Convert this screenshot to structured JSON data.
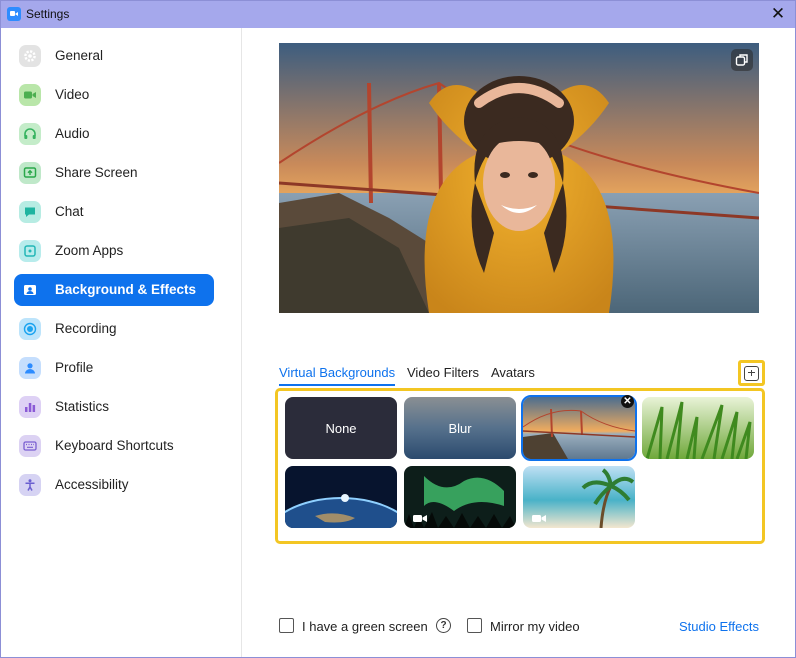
{
  "window": {
    "title": "Settings",
    "close_icon": "close-icon"
  },
  "sidebar": {
    "items": [
      {
        "label": "General",
        "icon": "gear-icon",
        "color": "#8a8a8a",
        "active": false
      },
      {
        "label": "Video",
        "icon": "video-camera-icon",
        "color": "#4caf50",
        "active": false
      },
      {
        "label": "Audio",
        "icon": "headphones-icon",
        "color": "#35b35f",
        "active": false
      },
      {
        "label": "Share Screen",
        "icon": "share-screen-icon",
        "color": "#2aa84a",
        "active": false
      },
      {
        "label": "Chat",
        "icon": "chat-bubble-icon",
        "color": "#1fb4a0",
        "active": false
      },
      {
        "label": "Zoom Apps",
        "icon": "apps-icon",
        "color": "#22b7b7",
        "active": false
      },
      {
        "label": "Background & Effects",
        "icon": "person-card-icon",
        "color": "#0e72ed",
        "active": true
      },
      {
        "label": "Recording",
        "icon": "record-icon",
        "color": "#1aa3f0",
        "active": false
      },
      {
        "label": "Profile",
        "icon": "person-icon",
        "color": "#2d8cff",
        "active": false
      },
      {
        "label": "Statistics",
        "icon": "bar-chart-icon",
        "color": "#8b5ad6",
        "active": false
      },
      {
        "label": "Keyboard Shortcuts",
        "icon": "keyboard-icon",
        "color": "#7a5ed1",
        "active": false
      },
      {
        "label": "Accessibility",
        "icon": "accessibility-icon",
        "color": "#6a5fd0",
        "active": false
      }
    ]
  },
  "preview": {
    "pip_icon": "picture-in-picture-icon"
  },
  "tabs": [
    {
      "label": "Virtual Backgrounds",
      "active": true
    },
    {
      "label": "Video Filters",
      "active": false
    },
    {
      "label": "Avatars",
      "active": false
    }
  ],
  "add_button": {
    "icon": "add-icon"
  },
  "backgrounds": [
    {
      "label": "None",
      "kind": "none",
      "selected": false,
      "video": false
    },
    {
      "label": "Blur",
      "kind": "blur",
      "selected": false,
      "video": false
    },
    {
      "label": "",
      "kind": "golden-gate-bridge",
      "selected": true,
      "video": false
    },
    {
      "label": "",
      "kind": "grass",
      "selected": false,
      "video": false
    },
    {
      "label": "",
      "kind": "earth-from-space",
      "selected": false,
      "video": false
    },
    {
      "label": "",
      "kind": "aurora",
      "selected": false,
      "video": true
    },
    {
      "label": "",
      "kind": "beach-palm",
      "selected": false,
      "video": true
    }
  ],
  "footer": {
    "green_screen_label": "I have a green screen",
    "green_screen_checked": false,
    "help_icon": "help-icon",
    "mirror_label": "Mirror my video",
    "mirror_checked": false,
    "studio_effects_label": "Studio Effects"
  },
  "colors": {
    "accent": "#0e72ed",
    "highlight": "#f3c623",
    "titlebar": "#a5a8ec"
  }
}
